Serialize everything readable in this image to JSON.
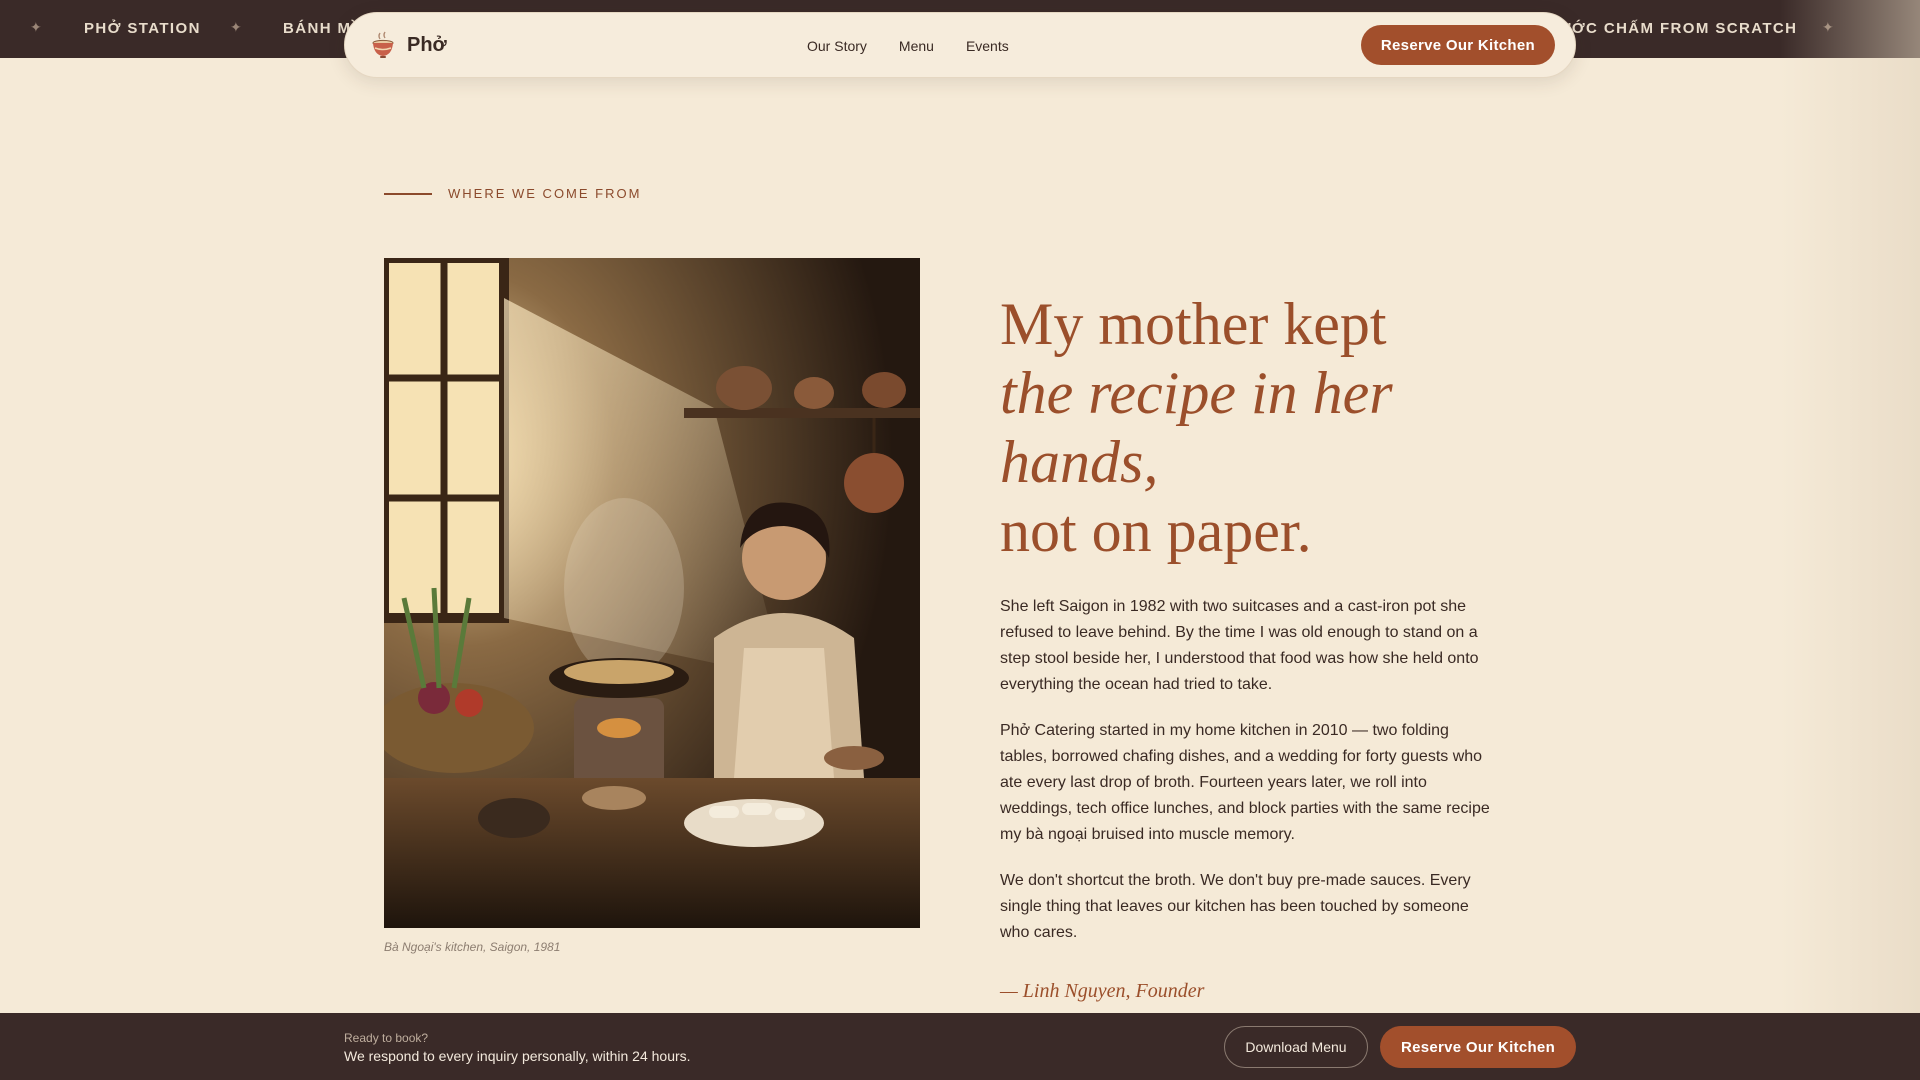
{
  "ticker": {
    "items": [
      "PHỞ STATION",
      "BÁNH MÌ",
      "ƯỚC CHẤM FROM SCRATCH"
    ],
    "separator": "✦"
  },
  "nav": {
    "brand": "Phở",
    "links": [
      "Our Story",
      "Menu",
      "Events"
    ],
    "cta": "Reserve Our Kitchen"
  },
  "story": {
    "eyebrow": "WHERE WE COME FROM",
    "headline": {
      "line1": "My mother kept",
      "line2": "the recipe in her",
      "line3": "hands,",
      "line4": "not on paper."
    },
    "paragraphs": [
      "She left Saigon in 1982 with two suitcases and a cast-iron pot she refused to leave behind. By the time I was old enough to stand on a step stool beside her, I understood that food was how she held onto everything the ocean had tried to take.",
      "Phở Catering started in my home kitchen in 2010 — two folding tables, borrowed chafing dishes, and a wedding for forty guests who ate every last drop of broth. Fourteen years later, we roll into weddings, tech office lunches, and block parties with the same recipe my bà ngoại bruised into muscle memory.",
      "We don't shortcut the broth. We don't buy pre-made sauces. Every single thing that leaves our kitchen has been touched by someone who cares."
    ],
    "signature": "— Linh Nguyen, Founder",
    "photo_caption": "Bà Ngoại's kitchen, Saigon, 1981"
  },
  "cta_bar": {
    "kicker": "Ready to book?",
    "message": "We respond to every inquiry personally, within 24 hours.",
    "secondary_button": "Download Menu",
    "primary_button": "Reserve Our Kitchen"
  },
  "colors": {
    "background": "#f5ead7",
    "dark": "#3a2a28",
    "accent": "#a24f2c",
    "headline": "#9b4f2b"
  },
  "icons": {
    "brand": "pho-bowl-icon",
    "separator": "sparkle-icon"
  }
}
